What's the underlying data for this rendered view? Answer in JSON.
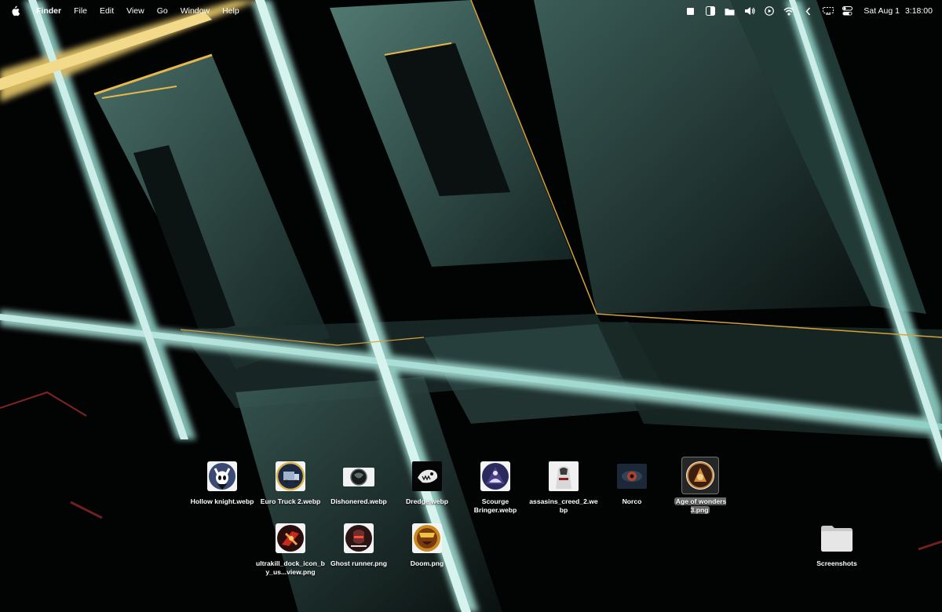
{
  "menubar": {
    "apple_icon": "apple-icon",
    "app_name": "Finder",
    "menus": [
      "File",
      "Edit",
      "View",
      "Go",
      "Window",
      "Help"
    ],
    "status_icons": [
      "stop-icon",
      "sidebar-icon",
      "folder-icon",
      "volume-icon",
      "play-circle-icon",
      "wifi-icon",
      "chevron-left-icon",
      "display-icon",
      "control-center-icon"
    ],
    "date": "Sat Aug 1",
    "time": "3:18:00"
  },
  "desktop": {
    "files": [
      {
        "label": "Hollow knight.webp",
        "icon": "hollow-knight-icon",
        "selected": false
      },
      {
        "label": "Euro Truck 2.webp",
        "icon": "euro-truck-icon",
        "selected": false
      },
      {
        "label": "Dishonered.webp",
        "icon": "dishonored-icon",
        "selected": false
      },
      {
        "label": "Dredge.webp",
        "icon": "dredge-icon",
        "selected": false
      },
      {
        "label": "Scourge Bringer.webp",
        "icon": "scourge-bringer-icon",
        "selected": false
      },
      {
        "label": "assasins_creed_2.webp",
        "icon": "assassins-creed-icon",
        "selected": false
      },
      {
        "label": "Norco",
        "icon": "norco-icon",
        "selected": false
      },
      {
        "label": "Age of wonders 3.png",
        "icon": "age-of-wonders-icon",
        "selected": true
      },
      {
        "label": "ultrakill_dock_icon_by_us...view.png",
        "icon": "ultrakill-icon",
        "selected": false
      },
      {
        "label": "Ghost runner.png",
        "icon": "ghost-runner-icon",
        "selected": false
      },
      {
        "label": "Doom.png",
        "icon": "doom-icon",
        "selected": false
      }
    ],
    "folders": [
      {
        "label": "Screenshots",
        "icon": "folder-icon"
      }
    ]
  }
}
